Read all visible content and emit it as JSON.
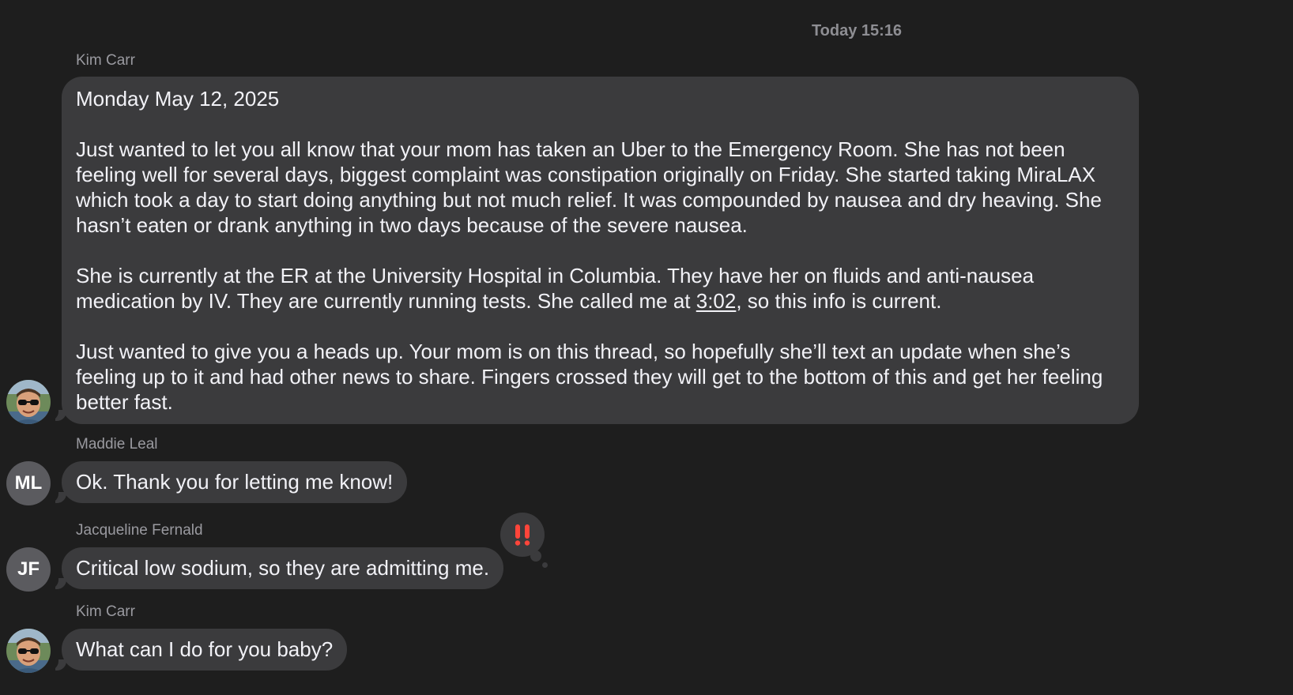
{
  "thread": {
    "timestamp": "Today 15:16",
    "messages": [
      {
        "sender": "Kim Carr",
        "avatar": "photo",
        "paragraphs": [
          "Monday May 12, 2025",
          "Just wanted to let you all know that your mom has taken an Uber to the Emergency Room. She has not been feeling well for several days, biggest complaint was constipation originally on Friday. She started taking MiraLAX which took a day to start doing anything but not much relief. It was compounded by nausea and dry heaving. She hasn’t eaten or drank anything in two days because of the severe nausea.",
          "She is currently at the ER at the University Hospital in Columbia. They have her on fluids and anti-nausea medication by IV. They are currently running tests. She called me at ",
          "Just wanted to give you a heads up. Your mom is on this thread, so hopefully she’ll text an update when she’s feeling up to it and had other news to share. Fingers crossed they will get to the bottom of this and get her feeling better fast."
        ],
        "link_time": "3:02",
        "after_link": ", so this info is current."
      },
      {
        "sender": "Maddie Leal",
        "avatar": "initials",
        "initials": "ML",
        "text": "Ok. Thank you for letting me know!"
      },
      {
        "sender": "Jacqueline Fernald",
        "avatar": "initials",
        "initials": "JF",
        "text": "Critical low sodium, so they are admitting me.",
        "tapback": "!!",
        "tapback_icon": "double-exclamation-icon",
        "tapback_color": "#ff453a"
      },
      {
        "sender": "Kim Carr",
        "avatar": "photo",
        "text": "What can I do for you baby?"
      }
    ]
  },
  "colors": {
    "background": "#1e1e1e",
    "bubble": "#3b3b3d",
    "sender_label": "#9a9aa0",
    "timestamp": "#8e8e93"
  }
}
